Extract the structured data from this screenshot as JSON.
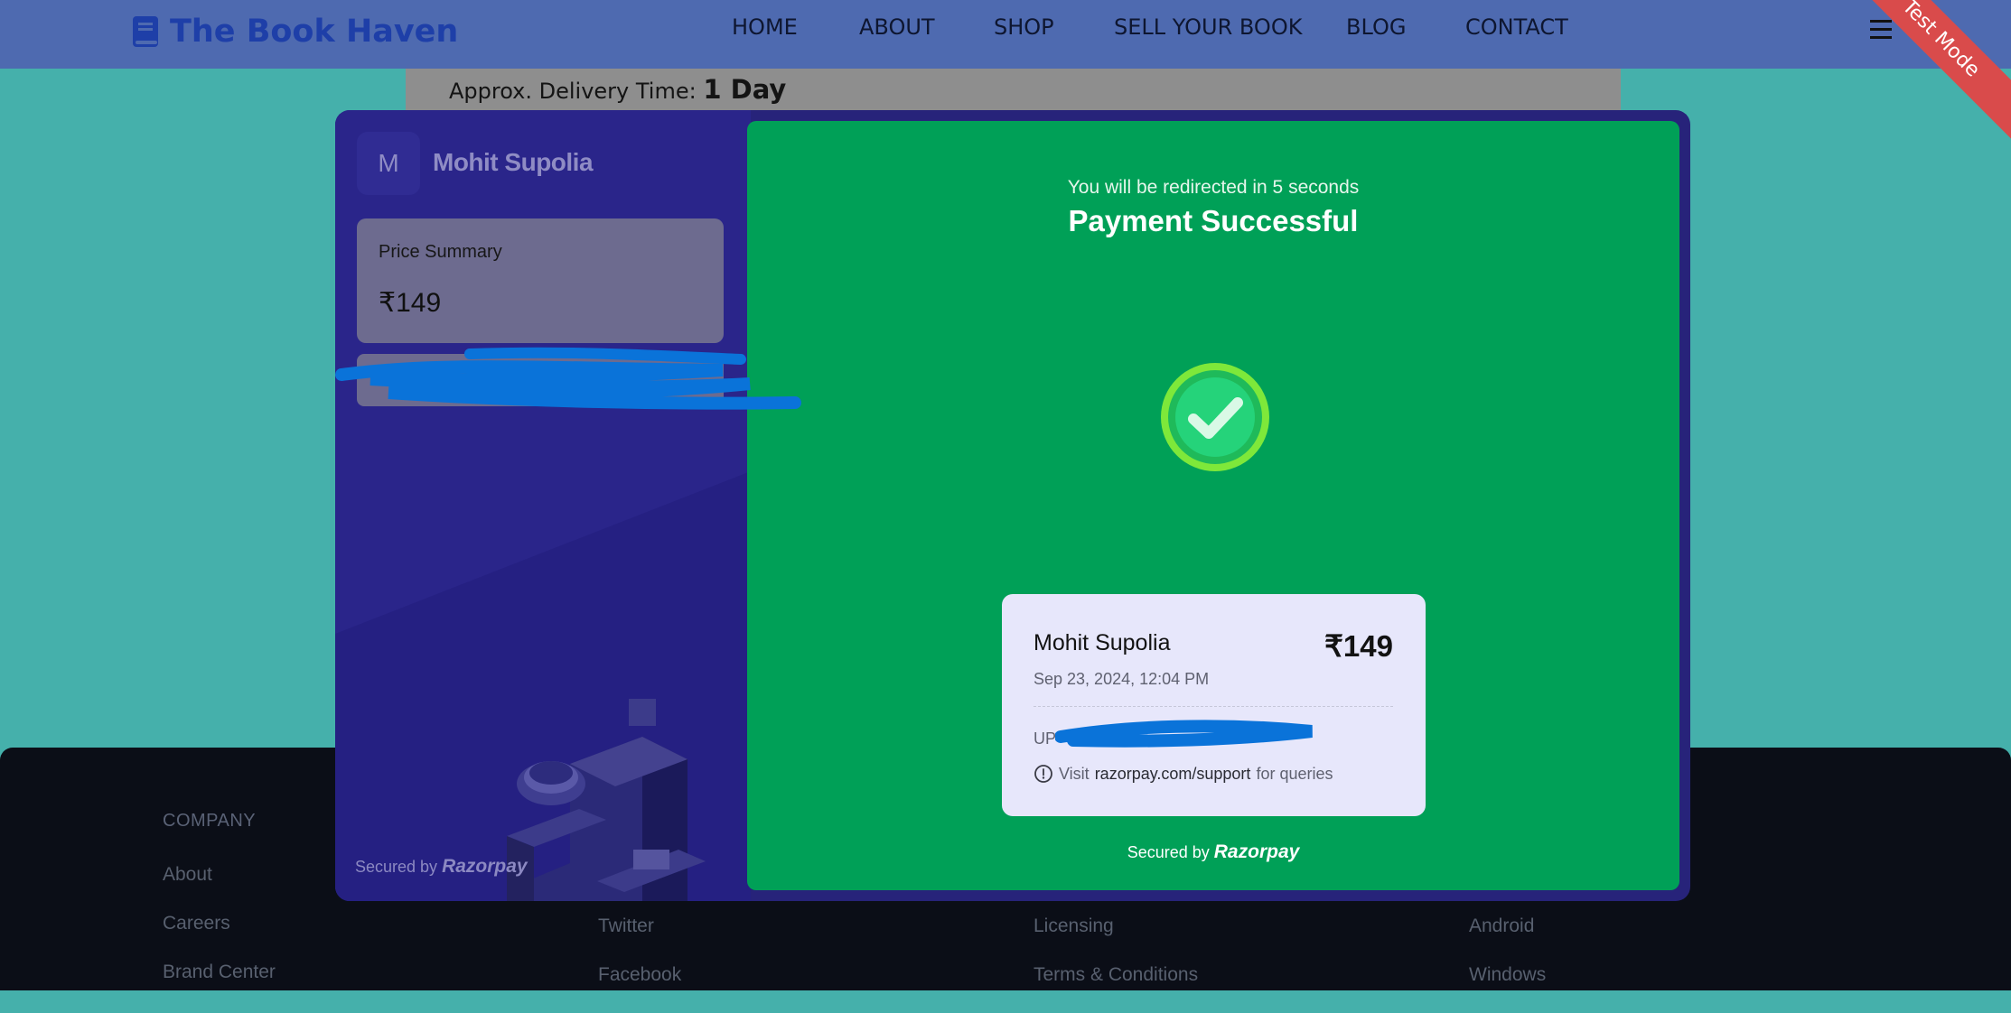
{
  "header": {
    "logo_text": "The Book Haven",
    "nav": [
      {
        "label": "HOME"
      },
      {
        "label": "ABOUT"
      },
      {
        "label": "SHOP"
      },
      {
        "label": "SELL YOUR BOOK"
      },
      {
        "label": "BLOG"
      },
      {
        "label": "CONTACT"
      }
    ],
    "ribbon": "Test Mode",
    "brand_color": "#1e3fa8"
  },
  "delivery": {
    "label": "Approx. Delivery Time:",
    "value": "1 Day"
  },
  "footer": {
    "columns": [
      {
        "heading": "COMPANY",
        "links": [
          "About",
          "Careers",
          "Brand Center"
        ]
      },
      {
        "heading": "",
        "links": [
          "Twitter",
          "Facebook"
        ]
      },
      {
        "heading": "",
        "links": [
          "Licensing",
          "Terms & Conditions"
        ]
      },
      {
        "heading": "",
        "links": [
          "Android",
          "Windows"
        ]
      }
    ]
  },
  "checkout": {
    "merchant_initial": "M",
    "merchant_name": "Mohit Supolia",
    "price_summary_label": "Price Summary",
    "price_summary_value": "₹149",
    "secured_by": "Secured by",
    "provider": "Razorpay",
    "success": {
      "redirect_text": "You will be redirected in 5 seconds",
      "title": "Payment Successful",
      "panel_color": "#00a057"
    },
    "receipt": {
      "name": "Mohit Supolia",
      "amount": "₹149",
      "date": "Sep 23, 2024, 12:04 PM",
      "method_prefix": "UP",
      "support_prefix": "Visit",
      "support_link": "razorpay.com/support",
      "support_suffix": "for queries"
    }
  }
}
